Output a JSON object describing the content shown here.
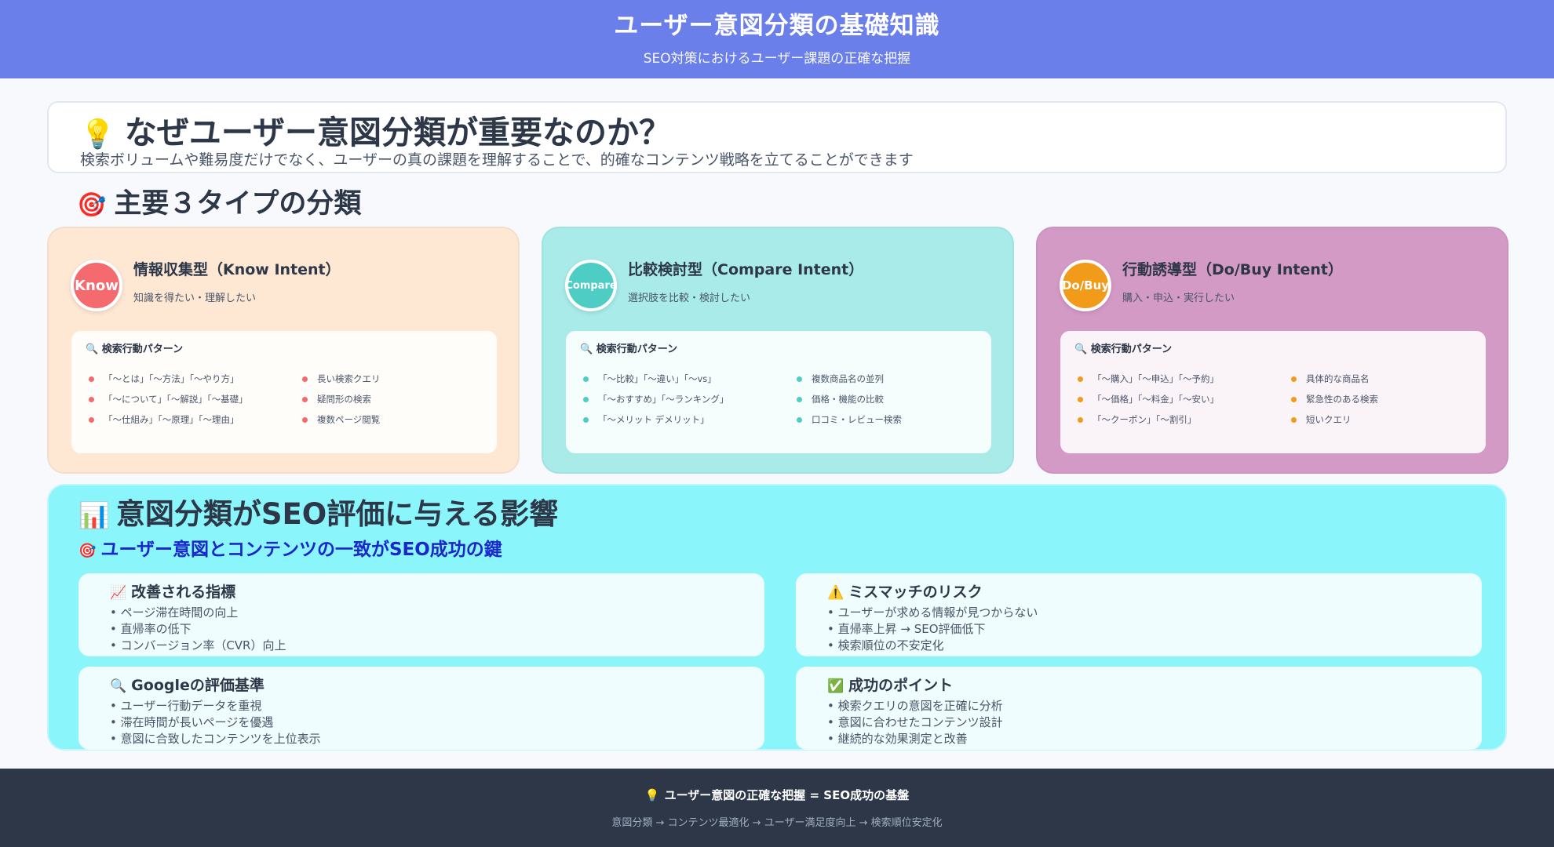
{
  "header": {
    "title": "ユーザー意図分類の基礎知識",
    "subtitle": "SEO対策におけるユーザー課題の正確な把握"
  },
  "why": {
    "icon": "💡",
    "title": "なぜユーザー意図分類が重要なのか？",
    "description": "検索ボリュームや難易度だけでなく、ユーザーの真の課題を理解することで、的確なコンテンツ戦略を立てることができます"
  },
  "types_section": {
    "icon": "🎯",
    "title": "主要３タイプの分類"
  },
  "cards": [
    {
      "badge": "Know",
      "title": "情報収集型（Know Intent）",
      "subtitle": "知識を得たい・理解したい",
      "pattern_icon": "🔍",
      "pattern_title": "検索行動パターン",
      "left_items": [
        "「〜とは」「〜方法」「〜やり方」",
        "「〜について」「〜解説」「〜基礎」",
        "「〜仕組み」「〜原理」「〜理由」"
      ],
      "right_items": [
        "長い検索クエリ",
        "疑問形の検索",
        "複数ページ閲覧"
      ],
      "color": "#f56a6e"
    },
    {
      "badge": "Compare",
      "title": "比較検討型（Compare Intent）",
      "subtitle": "選択肢を比較・検討したい",
      "pattern_icon": "🔍",
      "pattern_title": "検索行動パターン",
      "left_items": [
        "「〜比較」「〜違い」「〜vs」",
        "「〜おすすめ」「〜ランキング」",
        "「〜メリット デメリット」"
      ],
      "right_items": [
        "複数商品名の並列",
        "価格・機能の比較",
        "口コミ・レビュー検索"
      ],
      "color": "#4ecdc4"
    },
    {
      "badge": "Do/Buy",
      "title": "行動誘導型（Do/Buy Intent）",
      "subtitle": "購入・申込・実行したい",
      "pattern_icon": "🔍",
      "pattern_title": "検索行動パターン",
      "left_items": [
        "「〜購入」「〜申込」「〜予約」",
        "「〜価格」「〜料金」「〜安い」",
        "「〜クーポン」「〜割引」"
      ],
      "right_items": [
        "具体的な商品名",
        "緊急性のある検索",
        "短いクエリ"
      ],
      "color": "#f29a1a"
    }
  ],
  "impact": {
    "icon": "📊",
    "title": "意図分類がSEO評価に与える影響",
    "sub_icon": "🎯",
    "subtitle": "ユーザー意図とコンテンツの一致がSEO成功の鍵",
    "boxes": [
      {
        "icon": "📈",
        "title": "改善される指標",
        "items": [
          "• ページ滞在時間の向上",
          "• 直帰率の低下",
          "• コンバージョン率（CVR）向上"
        ]
      },
      {
        "icon": "⚠️",
        "title": "ミスマッチのリスク",
        "items": [
          "• ユーザーが求める情報が見つからない",
          "• 直帰率上昇 → SEO評価低下",
          "• 検索順位の不安定化"
        ]
      },
      {
        "icon": "🔍",
        "title": "Googleの評価基準",
        "items": [
          "• ユーザー行動データを重視",
          "• 滞在時間が長いページを優遇",
          "• 意図に合致したコンテンツを上位表示"
        ]
      },
      {
        "icon": "✅",
        "title": "成功のポイント",
        "items": [
          "• 検索クエリの意図を正確に分析",
          "• 意図に合わせたコンテンツ設計",
          "• 継続的な効果測定と改善"
        ]
      }
    ]
  },
  "footer": {
    "icon": "💡",
    "main": "ユーザー意図の正確な把握 = SEO成功の基盤",
    "flow": "意図分類 → コンテンツ最適化 → ユーザー満足度向上 → 検索順位安定化"
  }
}
